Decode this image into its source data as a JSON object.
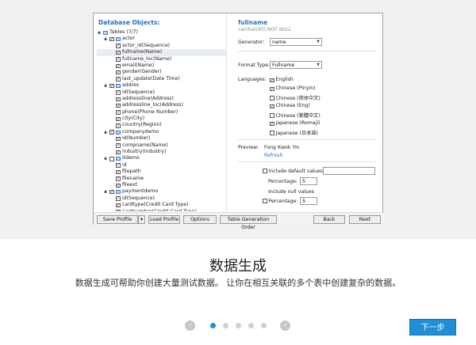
{
  "window": {
    "left_title": "Database Objects:",
    "tree": [
      {
        "indent": 0,
        "exp": "▲",
        "cb": "",
        "icon": true,
        "text": "Tables (7/7)",
        "sel": false
      },
      {
        "indent": 1,
        "exp": "▲",
        "cb": "✓",
        "icon": true,
        "text": "actor",
        "sel": false
      },
      {
        "indent": 2,
        "exp": "",
        "cb": "✓",
        "icon": false,
        "text": "actor_id(Sequence)",
        "sel": false
      },
      {
        "indent": 2,
        "exp": "",
        "cb": "✓",
        "icon": false,
        "text": "fullname(Name)",
        "sel": true
      },
      {
        "indent": 2,
        "exp": "",
        "cb": "✓",
        "icon": false,
        "text": "fullname_loc(Name)",
        "sel": false
      },
      {
        "indent": 2,
        "exp": "",
        "cb": "✓",
        "icon": false,
        "text": "email(Name)",
        "sel": false
      },
      {
        "indent": 2,
        "exp": "",
        "cb": "✓",
        "icon": false,
        "text": "gender(Gender)",
        "sel": false
      },
      {
        "indent": 2,
        "exp": "",
        "cb": "✓",
        "icon": false,
        "text": "last_update(Date Time)",
        "sel": false
      },
      {
        "indent": 1,
        "exp": "▲",
        "cb": "✓",
        "icon": true,
        "text": "addres",
        "sel": false
      },
      {
        "indent": 2,
        "exp": "",
        "cb": "✓",
        "icon": false,
        "text": "id(Sequence)",
        "sel": false
      },
      {
        "indent": 2,
        "exp": "",
        "cb": "✓",
        "icon": false,
        "text": "addressline(Address)",
        "sel": false
      },
      {
        "indent": 2,
        "exp": "",
        "cb": "✓",
        "icon": false,
        "text": "addressline_loc(Address)",
        "sel": false
      },
      {
        "indent": 2,
        "exp": "",
        "cb": "✓",
        "icon": false,
        "text": "phone(Phone Number)",
        "sel": false
      },
      {
        "indent": 2,
        "exp": "",
        "cb": "✓",
        "icon": false,
        "text": "city(City)",
        "sel": false
      },
      {
        "indent": 2,
        "exp": "",
        "cb": "✓",
        "icon": false,
        "text": "country(Region)",
        "sel": false
      },
      {
        "indent": 1,
        "exp": "▲",
        "cb": "✓",
        "icon": true,
        "text": "companydemo",
        "sel": false
      },
      {
        "indent": 2,
        "exp": "",
        "cb": "✓",
        "icon": false,
        "text": "id(Number)",
        "sel": false
      },
      {
        "indent": 2,
        "exp": "",
        "cb": "✓",
        "icon": false,
        "text": "compname(Name)",
        "sel": false
      },
      {
        "indent": 2,
        "exp": "",
        "cb": "✓",
        "icon": false,
        "text": "industry(Industry)",
        "sel": false
      },
      {
        "indent": 1,
        "exp": "▲",
        "cb": "",
        "icon": true,
        "text": "itdemo",
        "sel": false
      },
      {
        "indent": 2,
        "exp": "",
        "cb": "✓",
        "icon": false,
        "text": "id",
        "sel": false
      },
      {
        "indent": 2,
        "exp": "",
        "cb": "✓",
        "icon": false,
        "text": "filepath",
        "sel": false
      },
      {
        "indent": 2,
        "exp": "",
        "cb": "✓",
        "icon": false,
        "text": "filename",
        "sel": false
      },
      {
        "indent": 2,
        "exp": "",
        "cb": "✓",
        "icon": false,
        "text": "fileext",
        "sel": false
      },
      {
        "indent": 1,
        "exp": "▲",
        "cb": "✓",
        "icon": true,
        "text": "paymentdemo",
        "sel": false
      },
      {
        "indent": 2,
        "exp": "",
        "cb": "✓",
        "icon": false,
        "text": "id(Sequence)",
        "sel": false
      },
      {
        "indent": 2,
        "exp": "",
        "cb": "✓",
        "icon": false,
        "text": "cardtype(Credit Card Type)",
        "sel": false
      },
      {
        "indent": 2,
        "exp": "",
        "cb": "✓",
        "icon": false,
        "text": "cardnumber(Credit Card Type)",
        "sel": false
      }
    ],
    "right": {
      "field_name": "fullname",
      "field_type": "varchar(45) NOT NULL",
      "generator_label": "Generator:",
      "generator_value": "name",
      "format_label": "Format Type:",
      "format_value": "Fullname",
      "languages_label": "Languages:",
      "languages": [
        {
          "checked": true,
          "label": "English"
        },
        {
          "checked": true,
          "label": "Chinese (Pinyin)"
        },
        {
          "checked": false,
          "label": "Chinese (简体中文)"
        },
        {
          "checked": true,
          "label": "Chinese (Eng)"
        },
        {
          "checked": false,
          "label": "Chinese (繁體中文)"
        },
        {
          "checked": true,
          "label": "Japanese (Romaji)"
        },
        {
          "checked": false,
          "label": "Japanese (日本語)"
        }
      ],
      "preview_label": "Preview:",
      "preview_value": "Fong Kwok Yin",
      "refresh_label": "Refresh",
      "include_default_label": "Include default values",
      "percentage_label": "Percentage:",
      "percentage_value": "5",
      "include_null_label": "Include null values",
      "percentage2_label": "Percentage:",
      "percentage2_value": "5"
    },
    "buttons": {
      "save_profile": "Save Profile",
      "dropdown": "▾",
      "load_profile": "Load Profile",
      "options": "Options",
      "table_generation_order": "Table Generation Order",
      "back": "Back",
      "next": "Next"
    }
  },
  "slide": {
    "title": "数据生成",
    "description": "数据生成可帮助你创建大量测试数据。 让你在相互关联的多个表中创建复杂的数据。",
    "prev_arrow": "‹",
    "next_arrow": "›",
    "active_dot": 0,
    "dot_count": 5,
    "next_button": "下一步"
  }
}
